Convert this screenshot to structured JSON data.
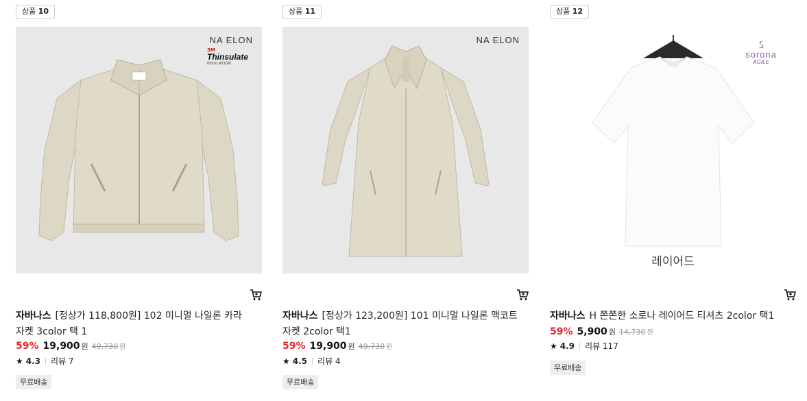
{
  "products": [
    {
      "tag_prefix": "상품",
      "tag_num": "10",
      "brand_mark": "NA ELON",
      "tech_logo": {
        "brand": "3M",
        "word": "Thinsulate",
        "sub": "INSULATION"
      },
      "brand": "자바나스",
      "title": "[정상가 118,800원] 102 미니멀 나일론 카라 자켓 3color 택 1",
      "discount": "59%",
      "price": "19,900",
      "currency": "원",
      "original_price": "49,730",
      "rating": "4.3",
      "review_label": "리뷰 7",
      "shipping": "무료배송",
      "garment": "beige zip-up collar jacket"
    },
    {
      "tag_prefix": "상품",
      "tag_num": "11",
      "brand_mark": "NA ELON",
      "brand": "자바나스",
      "title": "[정상가 123,200원] 101 미니멀 나일론 맥코트 자켓 2color 택1",
      "discount": "59%",
      "price": "19,900",
      "currency": "원",
      "original_price": "49,730",
      "rating": "4.5",
      "review_label": "리뷰 4",
      "shipping": "무료배송",
      "garment": "beige long mac coat"
    },
    {
      "tag_prefix": "상품",
      "tag_num": "12",
      "sorona_logo": {
        "mark": "ઽ",
        "word": "sorona",
        "sub": "AGILE"
      },
      "image_caption": "레이어드",
      "brand": "자바나스",
      "title": "H 쫀쫀한 소로나 레이어드 티셔츠 2color 택1",
      "discount": "59%",
      "price": "5,900",
      "currency": "원",
      "original_price": "14,730",
      "rating": "4.9",
      "review_label": "리뷰 117",
      "shipping": "무료배송",
      "garment": "white t-shirt on hanger"
    }
  ],
  "icons": {
    "cart": "cart-icon",
    "star": "star-icon"
  },
  "colors": {
    "discount": "#e5252a",
    "image_bg": "#e8e8e8",
    "garment_beige": "#ddd8c6"
  }
}
